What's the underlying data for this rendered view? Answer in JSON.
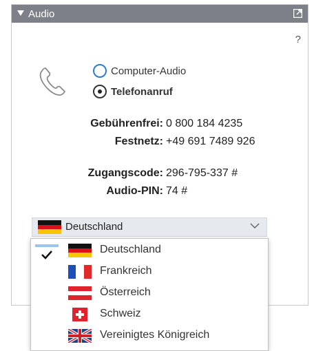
{
  "panel": {
    "title": "Audio",
    "help": "?"
  },
  "audio_options": [
    {
      "label": "Computer-Audio",
      "selected": false
    },
    {
      "label": "Telefonanruf",
      "selected": true
    }
  ],
  "info": [
    {
      "label": "Gebührenfrei:",
      "value": "0 800 184 4235"
    },
    {
      "label": "Festnetz:",
      "value": "+49 691 7489 926"
    },
    {
      "label": "Zugangscode:",
      "value": "296-795-337 #"
    },
    {
      "label": "Audio-PIN:",
      "value": "74 #"
    }
  ],
  "country_select": {
    "selected": "Deutschland"
  },
  "country_options": [
    {
      "label": "Deutschland",
      "flag": "flag-germany",
      "checked": true
    },
    {
      "label": "Frankreich",
      "flag": "flag-france",
      "checked": false
    },
    {
      "label": "Österreich",
      "flag": "flag-austria",
      "checked": false
    },
    {
      "label": "Schweiz",
      "flag": "flag-switzerland",
      "checked": false
    },
    {
      "label": "Vereinigtes Königreich",
      "flag": "flag-united-kingdom",
      "checked": false
    }
  ],
  "colors": {
    "titlebar": "#7d8088",
    "radio_accent": "#2a7bd6",
    "select_bg": "#e6e9ee"
  }
}
